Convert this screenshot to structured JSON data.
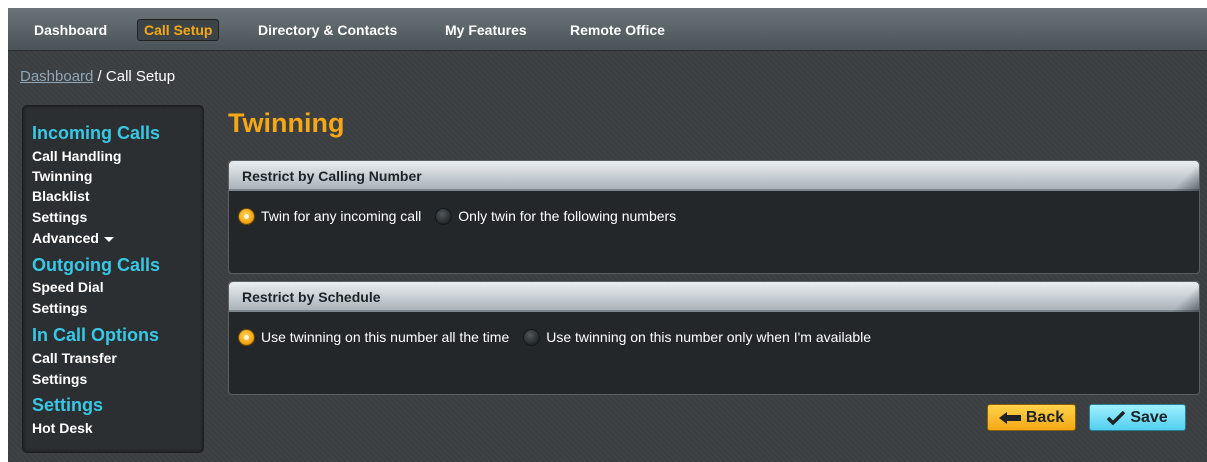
{
  "topnav": {
    "items": [
      {
        "label": "Dashboard",
        "active": false
      },
      {
        "label": "Call Setup",
        "active": true
      },
      {
        "label": "Directory & Contacts",
        "active": false
      },
      {
        "label": "My Features",
        "active": false
      },
      {
        "label": "Remote Office",
        "active": false
      }
    ]
  },
  "breadcrumb": {
    "link": "Dashboard",
    "separator": " / ",
    "current": "Call Setup"
  },
  "sidebar": {
    "sections": [
      {
        "heading": "Incoming Calls",
        "items": [
          "Call Handling",
          "Twinning",
          "Blacklist",
          "Settings",
          "Advanced"
        ]
      },
      {
        "heading": "Outgoing Calls",
        "items": [
          "Speed Dial",
          "Settings"
        ]
      },
      {
        "heading": "In Call Options",
        "items": [
          "Call Transfer",
          "Settings"
        ]
      },
      {
        "heading": "Settings",
        "items": [
          "Hot Desk"
        ]
      }
    ]
  },
  "page": {
    "title": "Twinning"
  },
  "panels": {
    "calling_number": {
      "title": "Restrict by Calling Number",
      "options": [
        {
          "label": "Twin for any incoming call",
          "checked": true
        },
        {
          "label": "Only twin for the following numbers",
          "checked": false
        }
      ]
    },
    "schedule": {
      "title": "Restrict by Schedule",
      "options": [
        {
          "label": "Use twinning on this number all the time",
          "checked": true
        },
        {
          "label": "Use twinning on this number only when I'm available",
          "checked": false
        }
      ]
    }
  },
  "actions": {
    "back_label": "Back",
    "save_label": "Save"
  },
  "colors": {
    "accent_orange": "#f5a814",
    "accent_cyan": "#38c8e6",
    "background": "#3c3f41"
  }
}
